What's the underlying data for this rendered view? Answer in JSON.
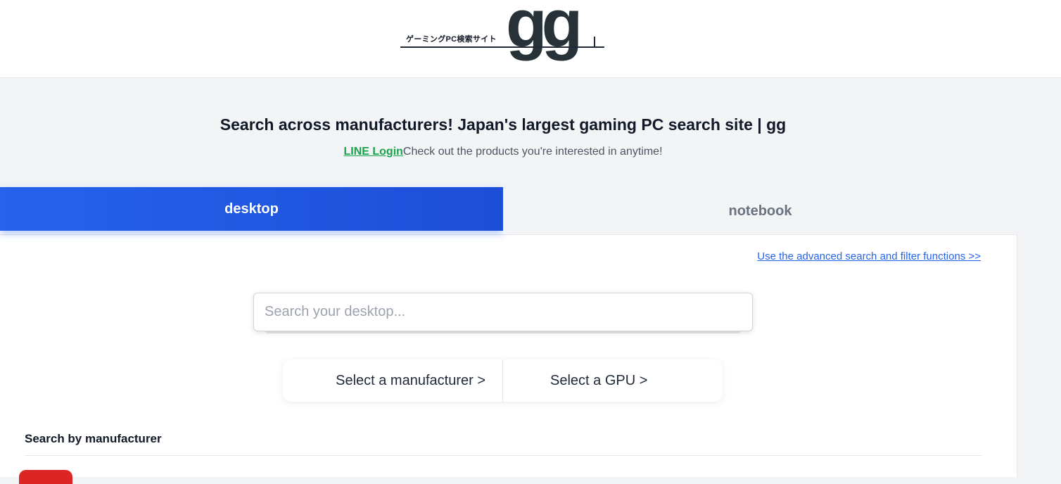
{
  "header": {
    "logo_tagline": "ゲーミングPC検索サイト",
    "logo_mark": "gg"
  },
  "hero": {
    "title": "Search across manufacturers! Japan's largest gaming PC search site | gg",
    "line_login": "LINE Login",
    "subtitle": "Check out the products you're interested in anytime!"
  },
  "tabs": {
    "desktop": "desktop",
    "notebook": "notebook",
    "active": "desktop"
  },
  "advanced_link": "Use the advanced search and filter functions >>",
  "search": {
    "placeholder": "Search your desktop...",
    "value": ""
  },
  "selectors": {
    "manufacturer": "Select a manufacturer >",
    "gpu": "Select a GPU >"
  },
  "section": {
    "title": "Search by manufacturer"
  },
  "colors": {
    "accent": "#2563eb",
    "line_green": "#16a34a",
    "maker_chip": "#dc2626"
  }
}
